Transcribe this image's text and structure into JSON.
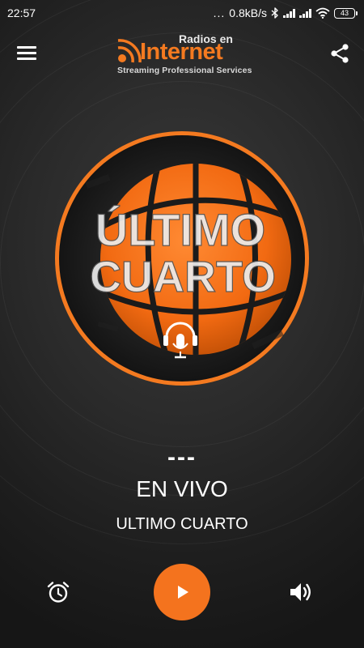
{
  "status_bar": {
    "time": "22:57",
    "dots": "...",
    "net_speed": "0.8kB/s",
    "battery_level": "43"
  },
  "app_bar": {
    "logo": {
      "top_text": "Radios en",
      "main_text": "Internet",
      "sub_text": "Streaming Professional Services"
    },
    "icons": {
      "menu": "menu-icon",
      "share": "share-icon"
    }
  },
  "station_art": {
    "line1": "ÚLTIMO",
    "line2": "CUARTO",
    "icon": "podcast-microphone-icon"
  },
  "now_playing": {
    "dashes": "---",
    "title": "EN VIVO",
    "station": "ULTIMO CUARTO"
  },
  "controls": {
    "alarm": "alarm-clock-icon",
    "play": "play-icon",
    "volume": "volume-icon"
  },
  "colors": {
    "accent": "#f4731e",
    "background": "#1e1e1e",
    "text": "#ffffff"
  }
}
